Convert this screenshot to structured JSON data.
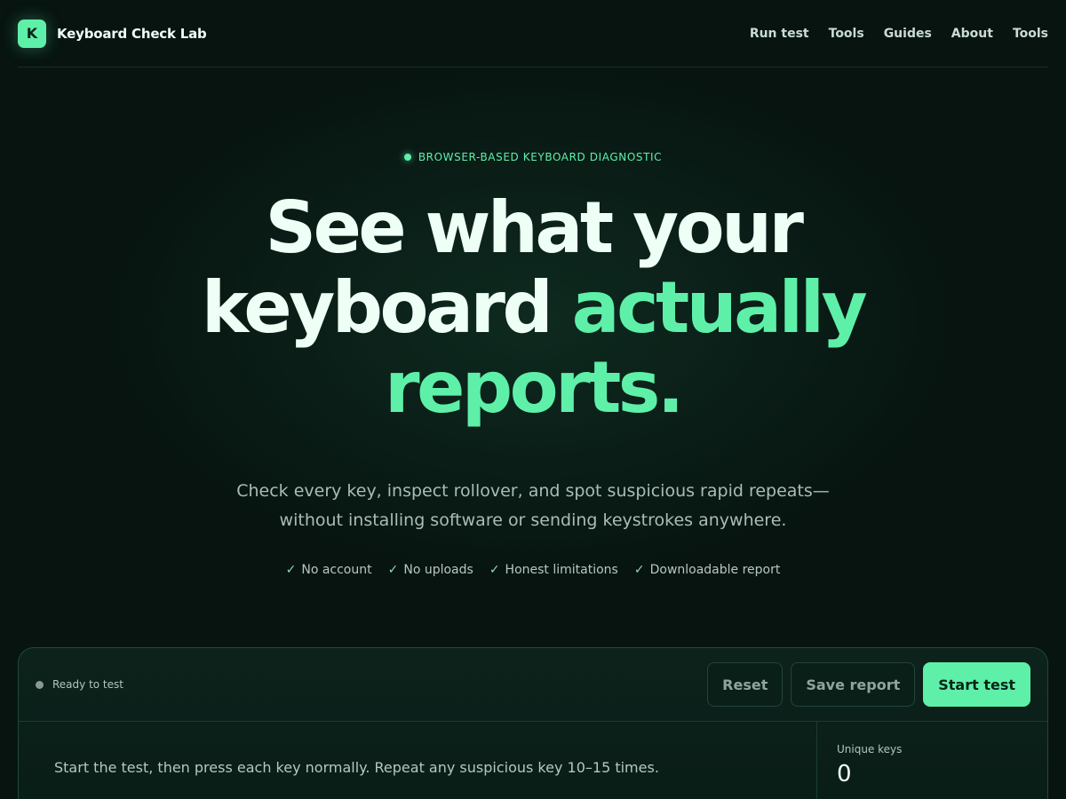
{
  "header": {
    "logo_letter": "K",
    "brand": "Keyboard Check Lab",
    "nav": [
      "Run test",
      "Tools",
      "Guides",
      "About",
      "Tools"
    ]
  },
  "hero": {
    "eyebrow": "BROWSER-BASED KEYBOARD DIAGNOSTIC",
    "headline_line1": "See what your",
    "headline_line2_plain": "keyboard ",
    "headline_line2_accent": "actually",
    "headline_line3_accent": "reports.",
    "lede_line1": "Check every key, inspect rollover, and spot suspicious rapid repeats—",
    "lede_line2": "without installing software or sending keystrokes anywhere.",
    "checks": [
      "No account",
      "No uploads",
      "Honest limitations",
      "Downloadable report"
    ],
    "check_glyph": "✓"
  },
  "panel": {
    "status": "Ready to test",
    "buttons": {
      "reset": "Reset",
      "save": "Save report",
      "start": "Start test"
    },
    "instructions": "Start the test, then press each key normally. Repeat any suspicious key 10–15 times.",
    "stat_label": "Unique keys",
    "stat_value": "0"
  },
  "colors": {
    "accent": "#5ef0a8",
    "background": "#071410"
  }
}
